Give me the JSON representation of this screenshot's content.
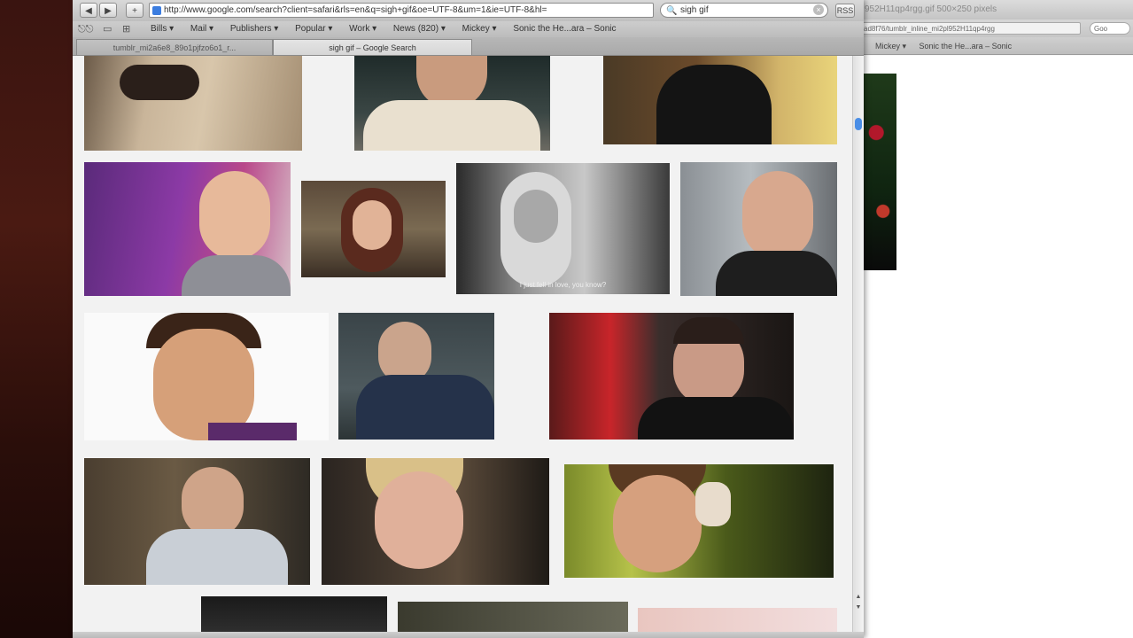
{
  "back_window": {
    "title": "952H11qp4rgg.gif 500×250 pixels",
    "url": "ad8f76/tumblr_inline_mi2pl952H11qp4rgg",
    "search": "Goo",
    "bookmarks": [
      "Mickey ▾",
      "Sonic the He...ara – Sonic"
    ]
  },
  "toolbar": {
    "back": "◀",
    "forward": "▶",
    "add": "+",
    "url": "http://www.google.com/search?client=safari&rls=en&q=sigh+gif&oe=UTF-8&um=1&ie=UTF-8&hl=",
    "search_value": "sigh gif",
    "search_glass": "🔍",
    "clear": "×",
    "reader": "RSS"
  },
  "bookmarks_bar": {
    "icons": [
      "⎋⎋",
      "▭",
      "⊞"
    ],
    "items": [
      "Bills ▾",
      "Mail ▾",
      "Publishers ▾",
      "Popular ▾",
      "Work ▾",
      "News (820) ▾",
      "Mickey ▾",
      "Sonic the He...ara – Sonic"
    ]
  },
  "tabs": {
    "inactive": "tumblr_mi2a6e8_89o1pjfzo6o1_r...",
    "active": "sigh gif – Google Search"
  },
  "colors": {
    "scroll_thumb": "#4a8ee6",
    "favicon": "#3b7de0"
  },
  "images": [
    {
      "caption": ""
    },
    {
      "caption": ""
    },
    {
      "caption": ""
    },
    {
      "caption": ""
    },
    {
      "caption": ""
    },
    {
      "caption": "I just fell in love, you know?"
    },
    {
      "caption": ""
    },
    {
      "caption": ""
    },
    {
      "caption": ""
    },
    {
      "caption": ""
    },
    {
      "caption": ""
    },
    {
      "caption": ""
    },
    {
      "caption": ""
    },
    {
      "caption": ""
    },
    {
      "caption": ""
    },
    {
      "caption": ""
    },
    {
      "caption": ""
    }
  ]
}
